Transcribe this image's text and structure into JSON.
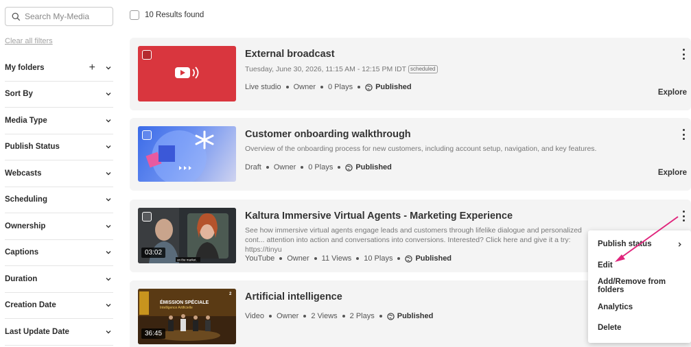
{
  "sidebar": {
    "search_placeholder": "Search My-Media",
    "clear_filters": "Clear all filters",
    "filters": [
      {
        "label": "My folders",
        "has_plus": true
      },
      {
        "label": "Sort By"
      },
      {
        "label": "Media Type"
      },
      {
        "label": "Publish Status"
      },
      {
        "label": "Webcasts"
      },
      {
        "label": "Scheduling"
      },
      {
        "label": "Ownership"
      },
      {
        "label": "Captions"
      },
      {
        "label": "Duration"
      },
      {
        "label": "Creation Date"
      },
      {
        "label": "Last Update Date"
      }
    ]
  },
  "results": {
    "count_label": "10 Results found"
  },
  "entries": [
    {
      "title": "External broadcast",
      "subtitle": "Tuesday, June 30, 2026, 11:15 AM - 12:15 PM IDT",
      "badge": "scheduled",
      "meta": [
        "Live studio",
        "Owner",
        "0 Plays"
      ],
      "status": "Published",
      "action": "Explore",
      "thumb_color": "#d9363e"
    },
    {
      "title": "Customer onboarding walkthrough",
      "description": "Overview of the onboarding process for new customers, including account setup, navigation, and key features.",
      "meta": [
        "Draft",
        "Owner",
        "0 Plays"
      ],
      "status": "Published",
      "action": "Explore"
    },
    {
      "title": "Kaltura Immersive Virtual Agents - Marketing Experience",
      "description": "See how immersive virtual agents engage leads and customers through lifelike dialogue and personalized cont... attention into action and conversations into conversions. Interested? Click here and give it a try: https://tinyu",
      "duration": "03:02",
      "thumb_caption": "on the market.",
      "meta": [
        "YouTube",
        "Owner",
        "11 Views",
        "10 Plays"
      ],
      "status": "Published"
    },
    {
      "title": "Artificial intelligence",
      "duration": "36:45",
      "thumb_text_1": "ÉMISSION SPÉCIALE",
      "thumb_text_2": "Intelligence Artificielle",
      "thumb_corner": "2",
      "meta": [
        "Video",
        "Owner",
        "2 Views",
        "2 Plays"
      ],
      "status": "Published"
    }
  ],
  "context_menu": {
    "items": [
      "Publish status",
      "Edit",
      "Add/Remove from folders",
      "Analytics",
      "Delete"
    ]
  },
  "colors": {
    "annotation_arrow": "#e0257c",
    "live_red": "#d9363e"
  }
}
